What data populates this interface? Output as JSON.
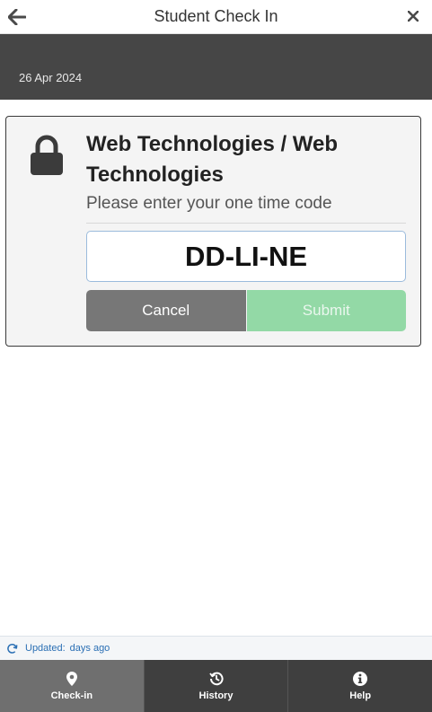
{
  "header": {
    "title": "Student Check In",
    "back_icon": "arrow-left-icon",
    "close_icon": "close-icon"
  },
  "band": {
    "date": "26 Apr 2024"
  },
  "card": {
    "lock_icon": "lock-icon",
    "course": "Web Technologies / Web Technologies",
    "prompt": "Please enter your one time code",
    "code_value": "DD-LI-NE",
    "cancel_label": "Cancel",
    "submit_label": "Submit"
  },
  "status": {
    "refresh_icon": "refresh-icon",
    "label": "Updated:",
    "value": "days ago"
  },
  "nav": {
    "tabs": [
      {
        "label": "Check-in",
        "icon": "map-pin-icon",
        "active": true
      },
      {
        "label": "History",
        "icon": "history-icon",
        "active": false
      },
      {
        "label": "Help",
        "icon": "info-icon",
        "active": false
      }
    ]
  },
  "colors": {
    "band": "#464646",
    "cancel": "#777777",
    "submit": "#93d9a6",
    "status_text": "#2a6fb4",
    "nav": "#3f3f3f",
    "nav_active": "#6f6f6f"
  }
}
